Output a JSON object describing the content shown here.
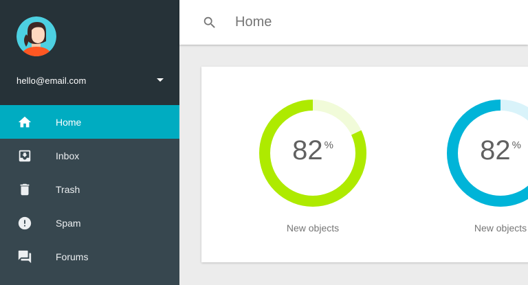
{
  "account": {
    "email": "hello@email.com"
  },
  "nav": {
    "items": [
      {
        "label": "Home",
        "icon": "home-icon",
        "active": true
      },
      {
        "label": "Inbox",
        "icon": "inbox-icon",
        "active": false
      },
      {
        "label": "Trash",
        "icon": "trash-icon",
        "active": false
      },
      {
        "label": "Spam",
        "icon": "spam-icon",
        "active": false
      },
      {
        "label": "Forums",
        "icon": "forums-icon",
        "active": false
      }
    ]
  },
  "topbar": {
    "title": "Home",
    "search_icon": "search-icon"
  },
  "stats": [
    {
      "value": "82",
      "unit": "%",
      "progress": 0.82,
      "label": "New objects",
      "color": "#aeea00",
      "track_color": "#f1fbd9"
    },
    {
      "value": "82",
      "unit": "%",
      "progress": 0.82,
      "label": "New objects",
      "color": "#00b4d8",
      "track_color": "#d9f3fa"
    }
  ],
  "colors": {
    "sidebar_header": "#263238",
    "sidebar": "#37474f",
    "active_item": "#00acc1"
  }
}
